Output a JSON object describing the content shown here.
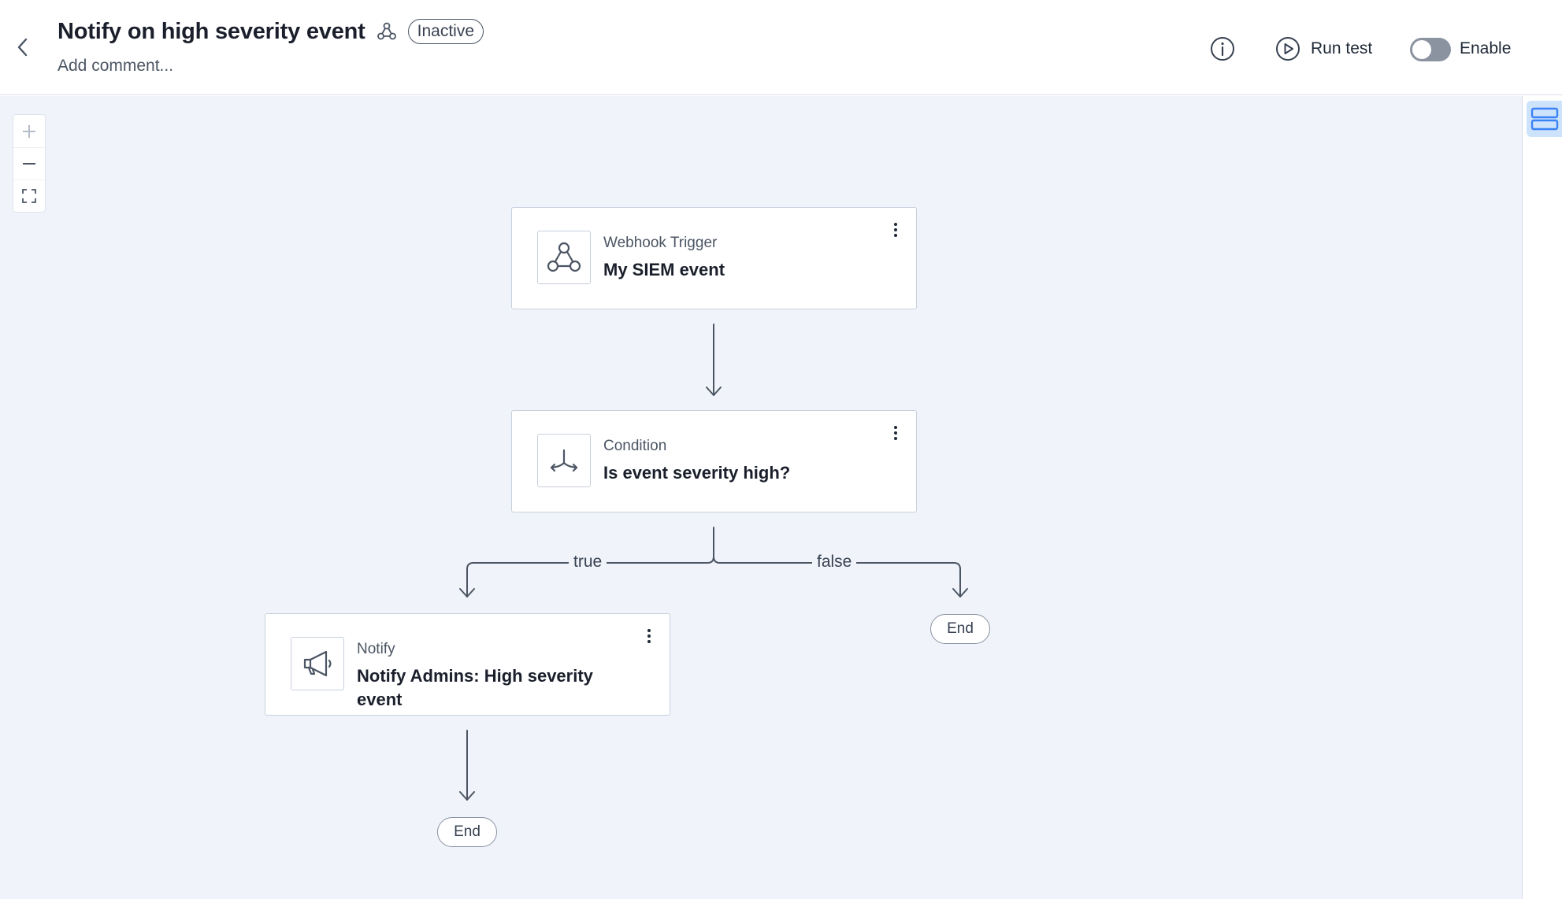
{
  "header": {
    "title": "Notify on high severity event",
    "status": "Inactive",
    "comment_placeholder": "Add comment...",
    "run_test_label": "Run test",
    "enable_label": "Enable",
    "enabled": false
  },
  "canvas": {
    "nodes": {
      "trigger": {
        "type": "Webhook Trigger",
        "name": "My SIEM event",
        "icon": "webhook-icon"
      },
      "condition": {
        "type": "Condition",
        "name": "Is event severity high?",
        "icon": "split-arrows-icon"
      },
      "notify": {
        "type": "Notify",
        "name": "Notify Admins: High severity event",
        "icon": "megaphone-icon"
      }
    },
    "branches": {
      "true_label": "true",
      "false_label": "false"
    },
    "end_label": "End"
  },
  "colors": {
    "canvas_bg": "#f0f4fa",
    "panel_toggle_bg": "#cde3fb",
    "panel_toggle_icon": "#3b82f6",
    "toggle_off": "#8b93a1"
  }
}
